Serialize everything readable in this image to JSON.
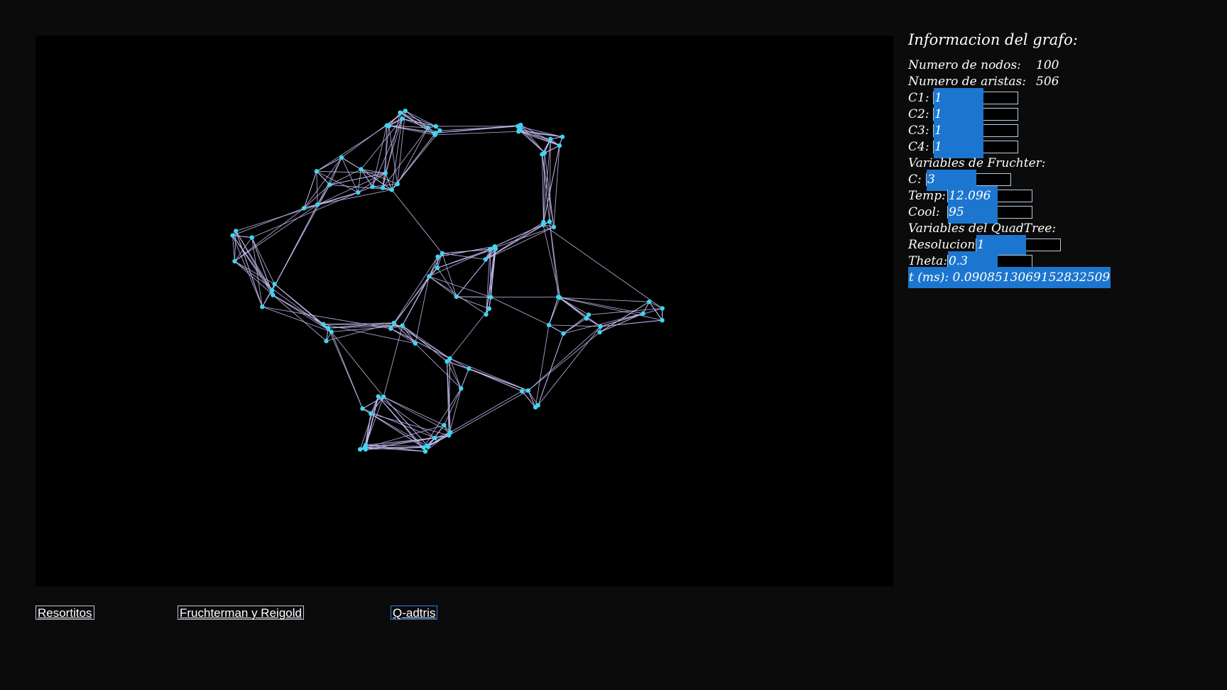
{
  "info": {
    "title": "Informacion del grafo:",
    "nodes_label": "Numero de nodos:",
    "nodes_value": "100",
    "edges_label": "Numero de aristas:",
    "edges_value": "506",
    "c1_label": "C1:",
    "c1_value": "1",
    "c2_label": "C2:",
    "c2_value": "1",
    "c3_label": "C3:",
    "c3_value": "1",
    "c4_label": "C4:",
    "c4_value": "1",
    "fruchter_header": "Variables de Fruchter:",
    "c_label": "C:",
    "c_value": "3",
    "temp_label": "Temp:",
    "temp_value": "12.096",
    "cool_label": "Cool:",
    "cool_value": "95",
    "quadtree_header": "Variables del QuadTree:",
    "res_label": "Resolucion:",
    "res_value": "1",
    "theta_label": "Theta:",
    "theta_value": "0.3",
    "time_text": "t (ms): 0.0908513069152832509"
  },
  "buttons": {
    "resortitos": "Resortitos",
    "fruchterman": "Fruchterman y Reigold",
    "quadtris": "Q-adtris"
  },
  "colors": {
    "background": "#0b0b0b",
    "canvas": "#000000",
    "edge": "#c8bff5",
    "node": "#3cd7f0",
    "accent": "#1c76cf",
    "field_border": "#b8cce4"
  },
  "graph": {
    "node_count": 100,
    "edge_count": 506
  }
}
